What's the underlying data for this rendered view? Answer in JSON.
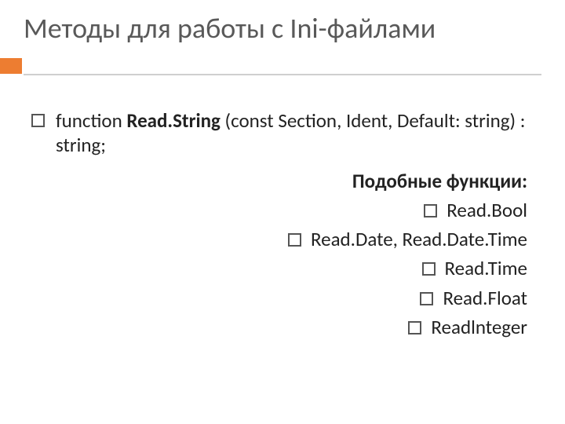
{
  "title": "Методы для работы с Ini-файлами",
  "main": {
    "prefix": "function ",
    "bold": "Read.String",
    "suffix": "  (const  Section, Ident, Default: string) : string;"
  },
  "subheading": "Подобные функции:",
  "similar": [
    "Read.Bool",
    "Read.Date, Read.Date.Time",
    "Read.Time",
    "Read.Float",
    "Readlnteger"
  ]
}
